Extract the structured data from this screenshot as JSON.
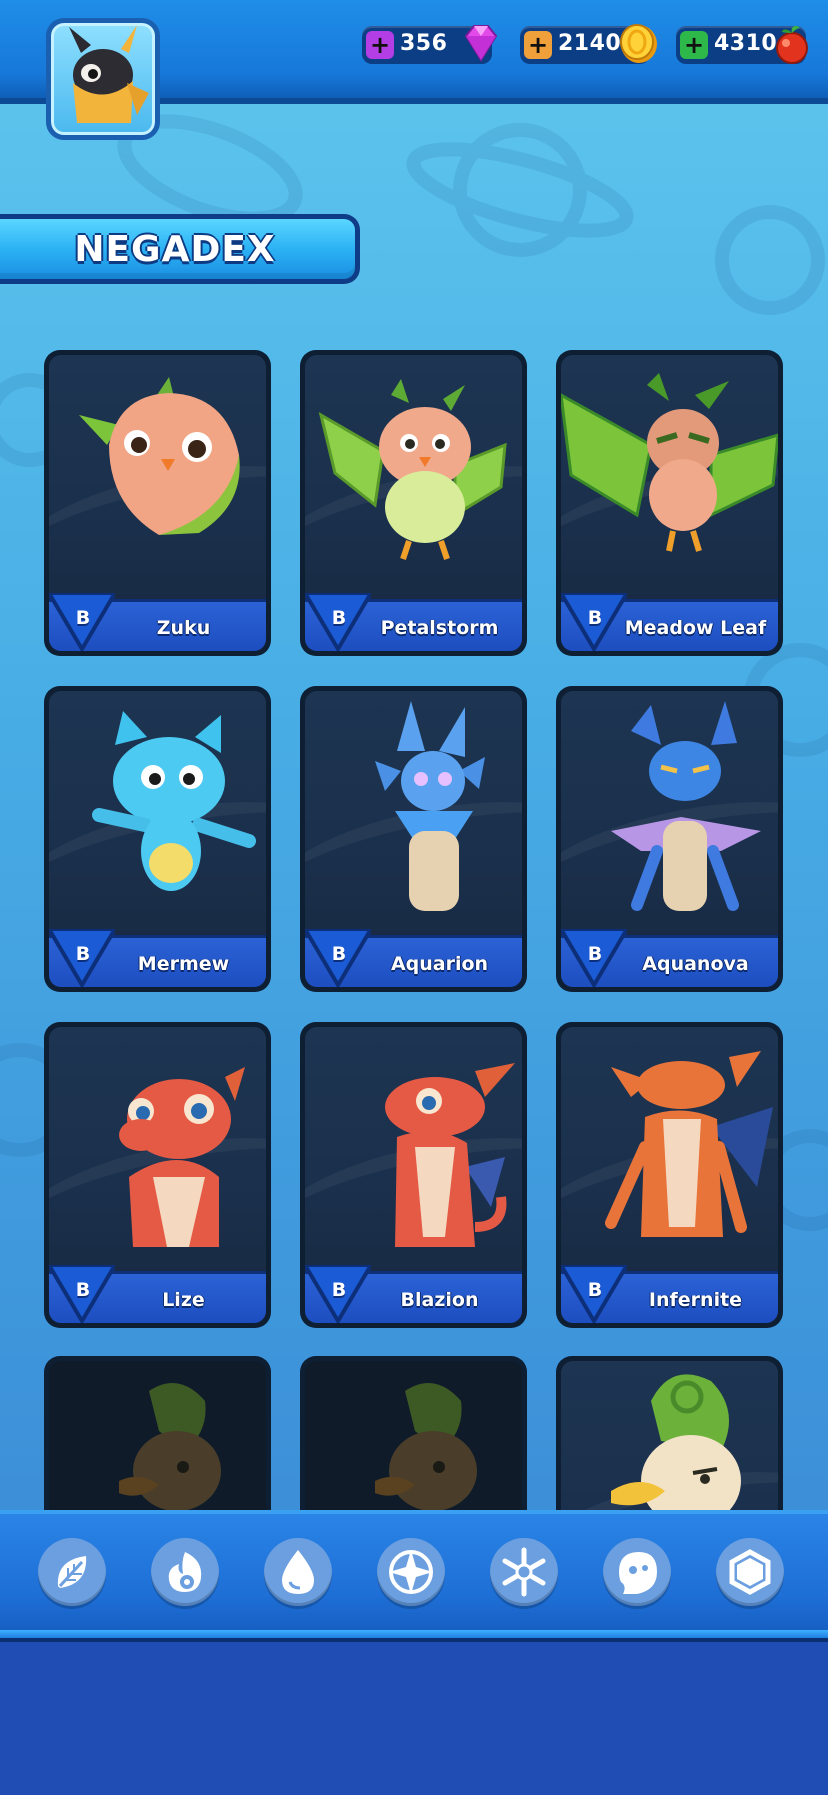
{
  "currencies": [
    {
      "name": "gems",
      "amount": "356",
      "icon": "gem-icon",
      "color": "#c838e8"
    },
    {
      "name": "coins",
      "amount": "2140",
      "icon": "coin-icon",
      "color": "#f2b01a"
    },
    {
      "name": "berries",
      "amount": "4310",
      "icon": "berry-icon",
      "color": "#e6402a"
    }
  ],
  "title": "NEGADEX",
  "creatures": [
    {
      "name": "Zuku",
      "rank": "B",
      "element": "grass"
    },
    {
      "name": "Petalstorm",
      "rank": "B",
      "element": "grass"
    },
    {
      "name": "Meadow Leaf",
      "rank": "B",
      "element": "grass"
    },
    {
      "name": "Mermew",
      "rank": "B",
      "element": "water"
    },
    {
      "name": "Aquarion",
      "rank": "B",
      "element": "water"
    },
    {
      "name": "Aquanova",
      "rank": "B",
      "element": "water"
    },
    {
      "name": "Lize",
      "rank": "B",
      "element": "fire"
    },
    {
      "name": "Blazion",
      "rank": "B",
      "element": "fire"
    },
    {
      "name": "Infernite",
      "rank": "B",
      "element": "fire"
    },
    {
      "name": "",
      "rank": "",
      "element": "grass",
      "locked": true
    },
    {
      "name": "",
      "rank": "",
      "element": "grass",
      "locked": true
    },
    {
      "name": "",
      "rank": "",
      "element": "grass"
    }
  ],
  "element_filters": [
    {
      "name": "grass",
      "icon": "leaf-icon"
    },
    {
      "name": "fire",
      "icon": "flame-icon"
    },
    {
      "name": "water",
      "icon": "droplet-icon"
    },
    {
      "name": "electric",
      "icon": "star-spark-icon"
    },
    {
      "name": "ice",
      "icon": "snowflake-icon"
    },
    {
      "name": "ghost",
      "icon": "ghost-icon"
    },
    {
      "name": "rock",
      "icon": "hexagon-icon"
    }
  ],
  "colors": {
    "topbar": "#1778d9",
    "card_bg": "#1a2f4b",
    "nameplate": "#2b62d6",
    "accent_light": "#5ad6ff"
  }
}
